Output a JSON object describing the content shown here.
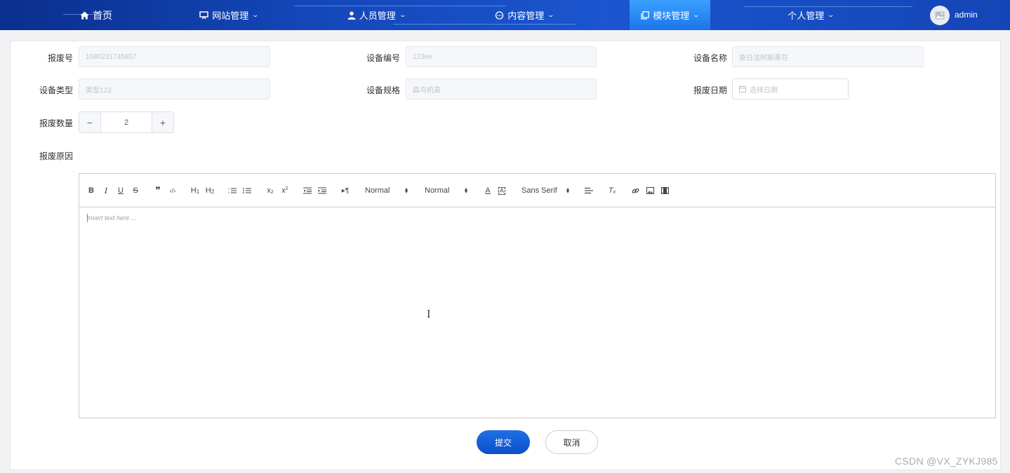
{
  "nav": {
    "items": [
      {
        "label": "首页",
        "icon": "home-icon"
      },
      {
        "label": "网站管理",
        "icon": "monitor-icon"
      },
      {
        "label": "人员管理",
        "icon": "user-icon"
      },
      {
        "label": "内容管理",
        "icon": "chat-icon"
      },
      {
        "label": "模块管理",
        "icon": "copy-icon",
        "active": true
      },
      {
        "label": "个人管理"
      }
    ],
    "username": "admin"
  },
  "form": {
    "scrap_no_label": "报废号",
    "scrap_no_value": "1680231745857",
    "device_no_label": "设备编号",
    "device_no_value": "123ee",
    "device_name_label": "设备名称",
    "device_name_value": "查日法阿斯蒂芬",
    "device_type_label": "设备类型",
    "device_type_value": "类型123",
    "device_spec_label": "设备规格",
    "device_spec_value": "森鸟机高",
    "scrap_date_label": "报废日期",
    "scrap_date_placeholder": "选择日期",
    "scrap_qty_label": "报废数量",
    "scrap_qty_value": "2",
    "scrap_reason_label": "报废原因"
  },
  "editor": {
    "header_picker": "Normal",
    "size_picker": "Normal",
    "font_picker": "Sans Serif",
    "placeholder": "Insert text here ..."
  },
  "actions": {
    "submit_label": "提交",
    "cancel_label": "取消"
  },
  "watermark": "CSDN @VX_ZYKJ985",
  "colors": {
    "nav_bg": "#1446b8",
    "nav_active": "#2a8cf5",
    "primary_button": "#0c4fc9"
  }
}
